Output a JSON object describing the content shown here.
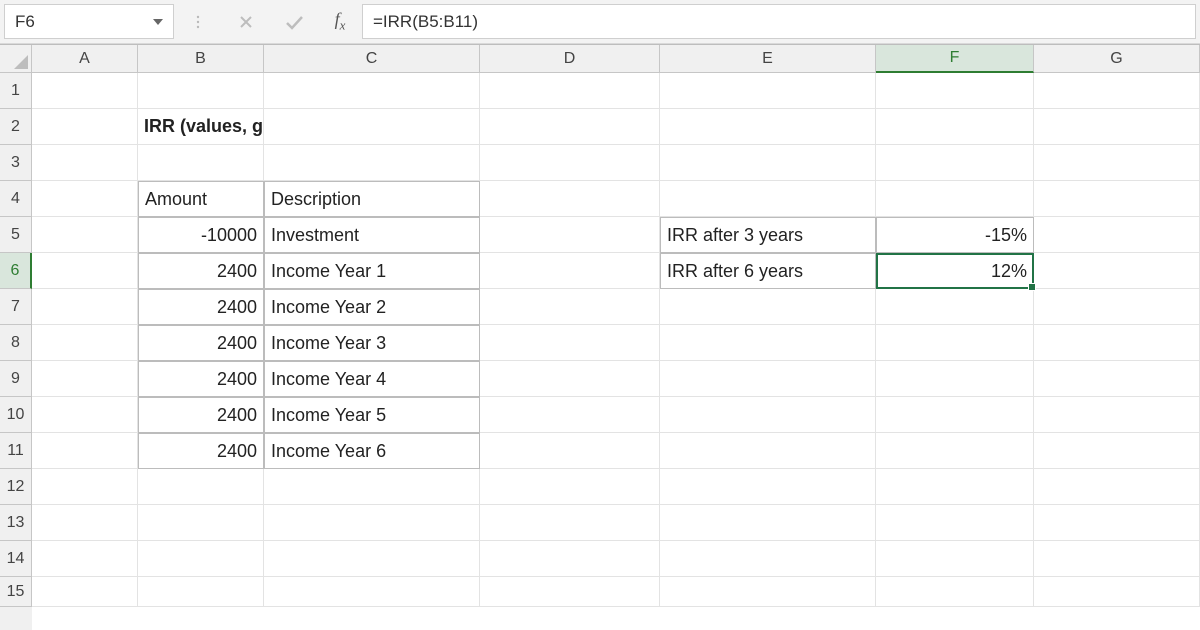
{
  "name_box": "F6",
  "formula": "=IRR(B5:B11)",
  "columns": [
    "A",
    "B",
    "C",
    "D",
    "E",
    "F",
    "G"
  ],
  "rows": [
    "1",
    "2",
    "3",
    "4",
    "5",
    "6",
    "7",
    "8",
    "9",
    "10",
    "11",
    "12",
    "13",
    "14",
    "15"
  ],
  "selected": {
    "col": "F",
    "row": 6
  },
  "heading": "IRR (values, guess)",
  "table": {
    "headers": {
      "amount": "Amount",
      "description": "Description"
    },
    "rows": [
      {
        "amount": "-10000",
        "description": "Investment"
      },
      {
        "amount": "2400",
        "description": "Income Year 1"
      },
      {
        "amount": "2400",
        "description": "Income Year 2"
      },
      {
        "amount": "2400",
        "description": "Income Year 3"
      },
      {
        "amount": "2400",
        "description": "Income Year 4"
      },
      {
        "amount": "2400",
        "description": "Income Year 5"
      },
      {
        "amount": "2400",
        "description": "Income Year 6"
      }
    ]
  },
  "results": [
    {
      "label": "IRR after 3 years",
      "value": "-15%"
    },
    {
      "label": "IRR after 6 years",
      "value": "12%"
    }
  ]
}
